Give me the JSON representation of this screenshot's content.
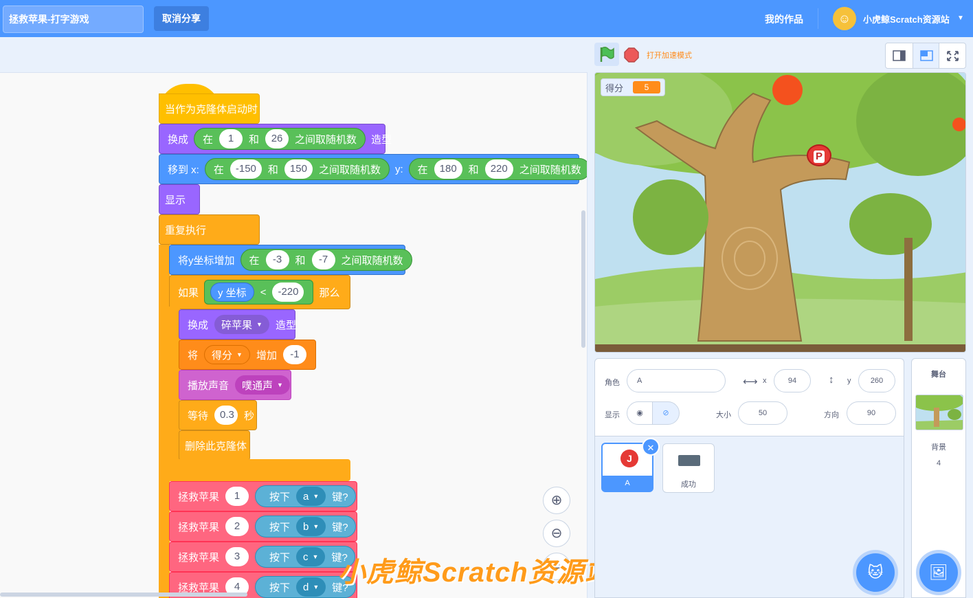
{
  "topbar": {
    "project_title": "拯救苹果-打字游戏",
    "unshare_label": "取消分享",
    "my_works_label": "我的作品",
    "username": "小虎鲸Scratch资源站",
    "bg_color": "#4c97ff"
  },
  "blocks": {
    "hat_label": "当作为克隆体启动时",
    "switch_costume": {
      "label": "换成",
      "op_in": "在",
      "from": "1",
      "and": "和",
      "to": "26",
      "op_tail": "之间取随机数",
      "suffix": "造型"
    },
    "goto": {
      "label": "移到 x:",
      "x_in": "在",
      "x_from": "-150",
      "x_and": "和",
      "x_to": "150",
      "x_tail": "之间取随机数",
      "y_label": "y:",
      "y_in": "在",
      "y_from": "180",
      "y_and": "和",
      "y_to": "220",
      "y_tail": "之间取随机数"
    },
    "show_label": "显示",
    "forever_label": "重复执行",
    "change_y": {
      "label": "将y坐标增加",
      "op_in": "在",
      "from": "-3",
      "and": "和",
      "to": "-7",
      "op_tail": "之间取随机数"
    },
    "if_block": {
      "label": "如果",
      "reporter": "y 坐标",
      "lt": "<",
      "value": "-220",
      "then": "那么"
    },
    "switch_broken": {
      "label": "换成",
      "costume": "碎苹果",
      "suffix": "造型"
    },
    "change_var": {
      "label": "将",
      "var": "得分",
      "by_label": "增加",
      "value": "-1"
    },
    "play_sound": {
      "label": "播放声音",
      "sound": "噗通声"
    },
    "wait": {
      "label": "等待",
      "value": "0.3",
      "unit": "秒"
    },
    "delete_clone": "删除此克隆体",
    "rescue": [
      {
        "label": "拯救苹果",
        "num": "1",
        "press": "按下",
        "key": "a",
        "suffix": "键?"
      },
      {
        "label": "拯救苹果",
        "num": "2",
        "press": "按下",
        "key": "b",
        "suffix": "键?"
      },
      {
        "label": "拯救苹果",
        "num": "3",
        "press": "按下",
        "key": "c",
        "suffix": "键?"
      },
      {
        "label": "拯救苹果",
        "num": "4",
        "press": "按下",
        "key": "d",
        "suffix": "键?"
      }
    ]
  },
  "watermark": "小虎鲸Scratch资源站",
  "stage_controls": {
    "turbo_label": "打开加速模式"
  },
  "stage": {
    "monitor_label": "得分",
    "monitor_value": "5",
    "sprite_letter": "P"
  },
  "sprite_info": {
    "sprite_label": "角色",
    "sprite_name": "A",
    "x_label": "x",
    "x_value": "94",
    "y_label": "y",
    "y_value": "260",
    "show_label": "显示",
    "size_label": "大小",
    "size_value": "50",
    "direction_label": "方向",
    "direction_value": "90"
  },
  "sprites": [
    {
      "name": "A",
      "letter": "J"
    },
    {
      "name": "成功"
    }
  ],
  "stage_panel": {
    "title": "舞台",
    "backdrop_label": "背景",
    "backdrop_count": "4"
  },
  "icons": {
    "flag": "green-flag-icon",
    "stop": "stop-icon",
    "small_stage": "small-stage-icon",
    "large_stage": "large-stage-icon",
    "fullscreen": "fullscreen-icon",
    "zoom_in": "zoom-in-icon",
    "zoom_out": "zoom-out-icon",
    "zoom_reset": "zoom-reset-icon",
    "delete": "trash-icon",
    "add_sprite": "cat-add-icon",
    "add_backdrop": "image-add-icon"
  }
}
